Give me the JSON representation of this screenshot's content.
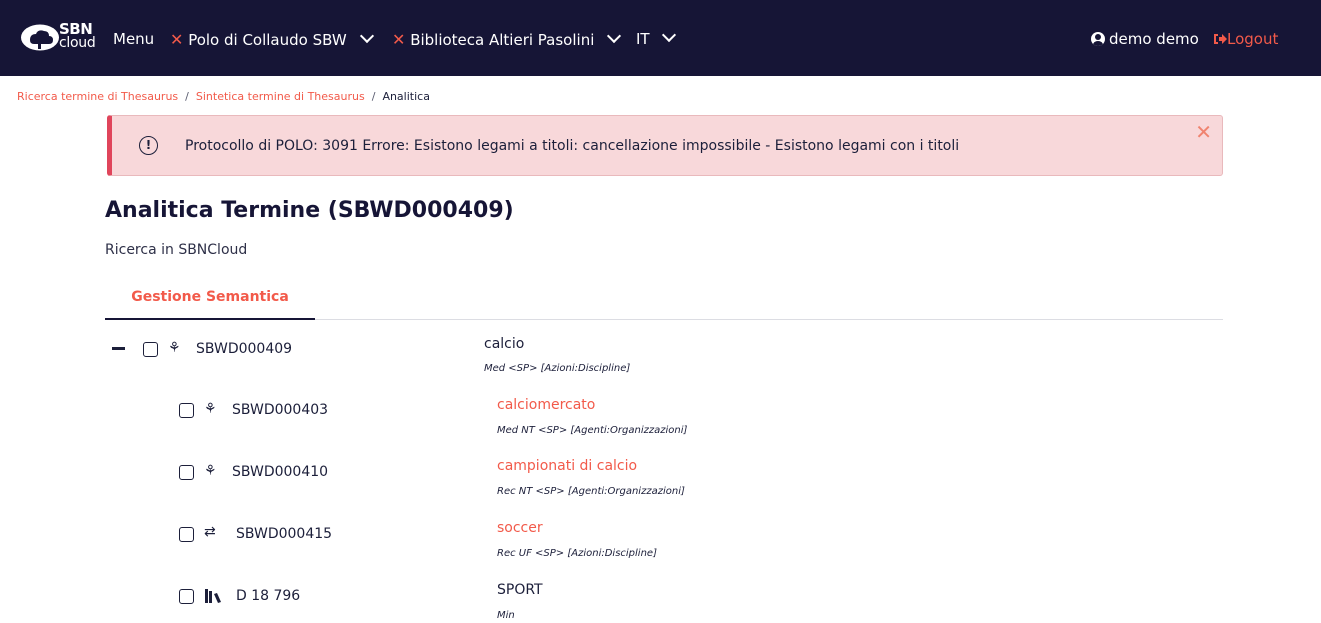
{
  "navbar": {
    "logo_top": "SBN",
    "logo_bottom": "cloud",
    "menu": "Menu",
    "polo": "Polo di Collaudo SBW",
    "biblioteca": "Biblioteca Altieri Pasolini",
    "lang": "IT",
    "user": "demo demo",
    "logout": "Logout",
    "x_glyph": "✕"
  },
  "breadcrumb": {
    "items": [
      "Ricerca termine di Thesaurus",
      "Sintetica termine di Thesaurus"
    ],
    "current": "Analitica",
    "separator": "/"
  },
  "alert": {
    "icon": "!",
    "message": "Protocollo di POLO: 3091 Errore: Esistono legami a titoli: cancellazione impossibile - Esistono legami con i titoli",
    "close": "✕"
  },
  "page": {
    "title": "Analitica Termine (SBWD000409)",
    "subtitle": "Ricerca in SBNCloud"
  },
  "tabs": [
    {
      "label": "Gestione Semantica",
      "active": true
    }
  ],
  "tree": {
    "root": {
      "code": "SBWD000409",
      "icon": "term-icon",
      "glyph": "⚘",
      "term": "calcio",
      "desc": "Med <SP> [Azioni:Discipline]",
      "expanded": true
    },
    "children": [
      {
        "code": "SBWD000403",
        "icon": "term-icon",
        "glyph": "⚘",
        "term": "calciomercato",
        "desc": "Med NT <SP> [Agenti:Organizzazioni]"
      },
      {
        "code": "SBWD000410",
        "icon": "term-icon",
        "glyph": "⚘",
        "term": "campionati di calcio",
        "desc": "Rec NT <SP> [Agenti:Organizzazioni]"
      },
      {
        "code": "SBWD000415",
        "icon": "exchange-icon",
        "glyph": "⇄",
        "term": "soccer",
        "desc": "Rec UF <SP> [Azioni:Discipline]"
      },
      {
        "code": "D 18 796",
        "icon": "books-icon",
        "glyph": "▮",
        "term": "SPORT",
        "desc": "Min"
      }
    ]
  },
  "colors": {
    "navbar": "#161536",
    "accent": "#f25a4a",
    "alert_bg": "#f8d8da",
    "alert_border": "#e0455b"
  }
}
